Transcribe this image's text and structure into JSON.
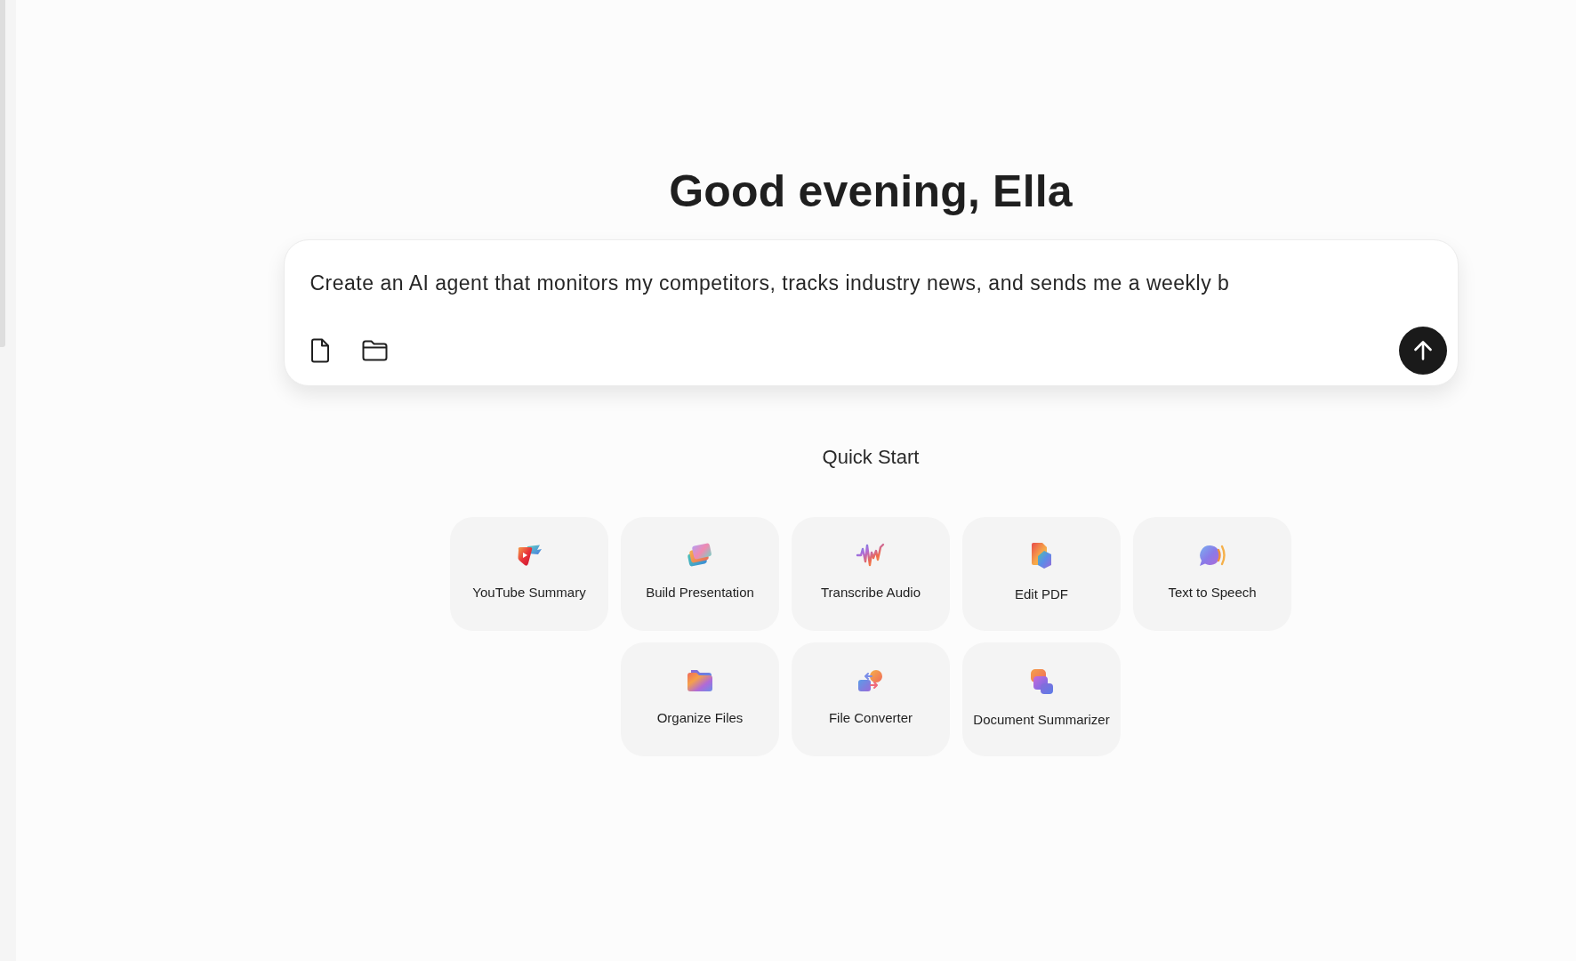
{
  "greeting": "Good evening, Ella",
  "prompt_box": {
    "value": "Create an AI agent that monitors my competitors, tracks industry news, and sends me a weekly b"
  },
  "quick_start": {
    "title": "Quick Start",
    "items": [
      {
        "label": "YouTube Summary"
      },
      {
        "label": "Build Presentation"
      },
      {
        "label": "Transcribe Audio"
      },
      {
        "label": "Edit PDF"
      },
      {
        "label": "Text to Speech"
      },
      {
        "label": "Organize Files"
      },
      {
        "label": "File Converter"
      },
      {
        "label": "Document Summarizer"
      }
    ]
  }
}
